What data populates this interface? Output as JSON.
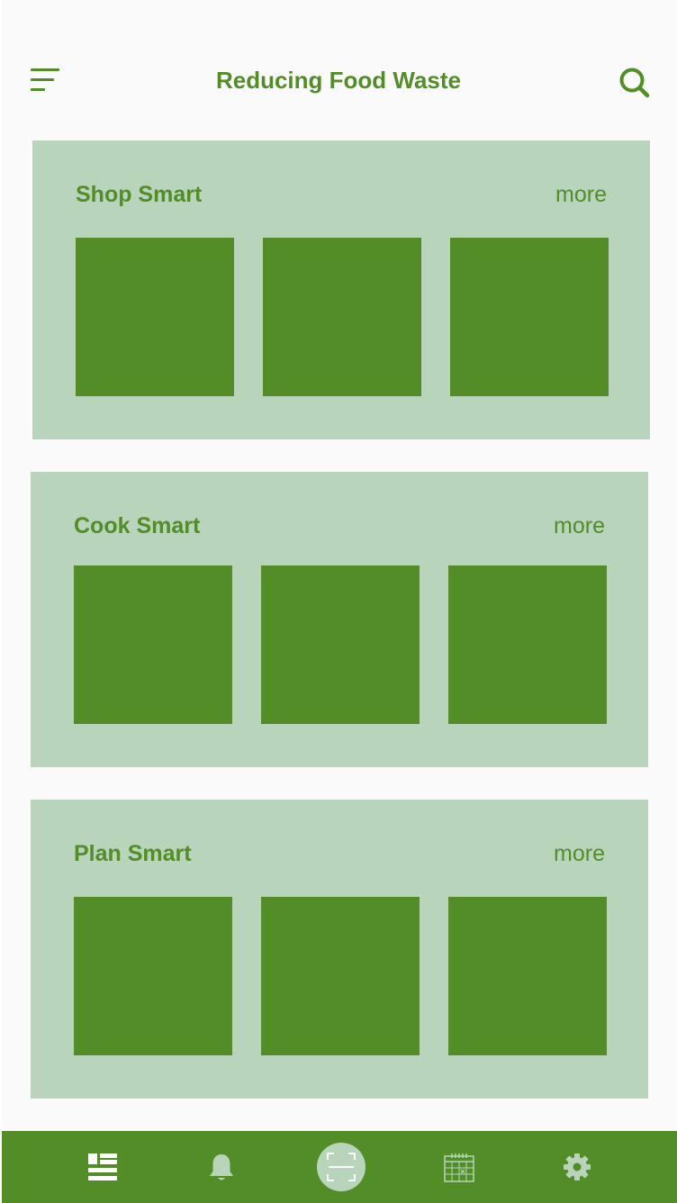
{
  "header": {
    "title": "Reducing Food Waste",
    "menu_icon": "menu-icon",
    "search_icon": "search-icon"
  },
  "sections": [
    {
      "title": "Shop Smart",
      "more_label": "more"
    },
    {
      "title": "Cook Smart",
      "more_label": "more"
    },
    {
      "title": "Plan Smart",
      "more_label": "more"
    }
  ],
  "bottom_nav": {
    "items": [
      {
        "icon": "list-icon"
      },
      {
        "icon": "bell-icon"
      },
      {
        "icon": "scan-icon"
      },
      {
        "icon": "calendar-icon"
      },
      {
        "icon": "gear-icon"
      }
    ]
  },
  "colors": {
    "primary": "#528d28",
    "card_background": "#b8d5bc",
    "page_background": "#fafafa"
  }
}
